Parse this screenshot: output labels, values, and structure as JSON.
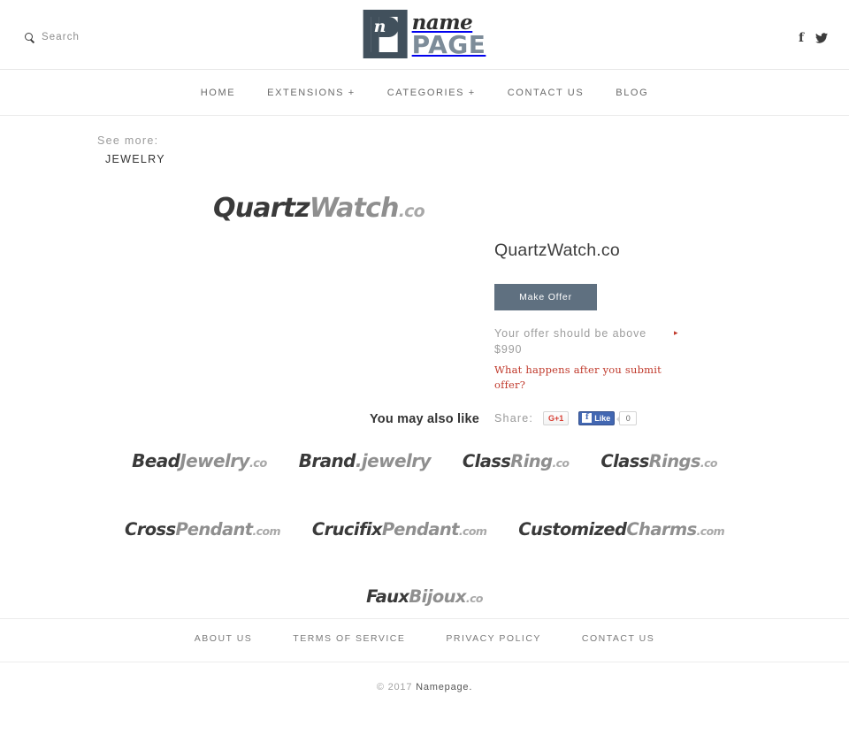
{
  "header": {
    "search": {
      "label": "Search",
      "icon": "search-icon"
    },
    "logo": {
      "mark_letter": "n",
      "script_text": "name",
      "bold_text": "PAGE",
      "colors": {
        "mark_bg": "#41505c",
        "page_text": "#7d8c99"
      }
    },
    "social": [
      {
        "name": "facebook",
        "glyph": "f"
      },
      {
        "name": "twitter",
        "glyph": "bird"
      }
    ]
  },
  "nav": {
    "items": [
      {
        "label": "HOME"
      },
      {
        "label": "EXTENSIONS +"
      },
      {
        "label": "CATEGORIES +"
      },
      {
        "label": "CONTACT US"
      },
      {
        "label": "BLOG"
      }
    ]
  },
  "see_more": {
    "label": "See more:",
    "category": "JEWELRY"
  },
  "domain_logo": {
    "part1": "Quartz",
    "part2": "Watch",
    "tld": ".co"
  },
  "panel": {
    "title": "QuartzWatch.co",
    "make_offer_label": "Make Offer",
    "offer_note_line1": "Your offer should be above",
    "offer_note_line2": "$990",
    "offer_arrow": "▸",
    "offer_link": "What happens after you submit offer?",
    "share_label": "Share:",
    "gplus_label": "G+1",
    "fb_like_label": "Like",
    "fb_like_glyph": "f",
    "fb_count": "0",
    "accent_red": "#c0392b",
    "button_color": "#5f7080"
  },
  "also_like": {
    "title": "You may also like",
    "items": [
      {
        "part1": "Bead",
        "part2": "Jewelry",
        "tld": ".co",
        "size": "sz-20"
      },
      {
        "part1": "Brand",
        "part2": ".jewelry",
        "tld": "",
        "size": "sz-20"
      },
      {
        "part1": "Class",
        "part2": "Ring",
        "tld": ".co",
        "size": "sz-19"
      },
      {
        "part1": "Class",
        "part2": "Rings",
        "tld": ".co",
        "size": "sz-19"
      },
      {
        "part1": "Cross",
        "part2": "Pendant",
        "tld": ".com",
        "size": "sz-19"
      },
      {
        "part1": "Crucifix",
        "part2": "Pendant",
        "tld": ".com",
        "size": "sz-19"
      },
      {
        "part1": "Customized",
        "part2": "Charms",
        "tld": ".com",
        "size": "sz-19"
      },
      {
        "part1": "Faux",
        "part2": "Bijoux",
        "tld": ".co",
        "size": "sz-19"
      }
    ]
  },
  "footer": {
    "links": [
      {
        "label": "ABOUT US"
      },
      {
        "label": "TERMS OF SERVICE"
      },
      {
        "label": "PRIVACY POLICY"
      },
      {
        "label": "CONTACT US"
      }
    ],
    "copyright_prefix": "© 2017 ",
    "copyright_brand": "Namepage."
  }
}
